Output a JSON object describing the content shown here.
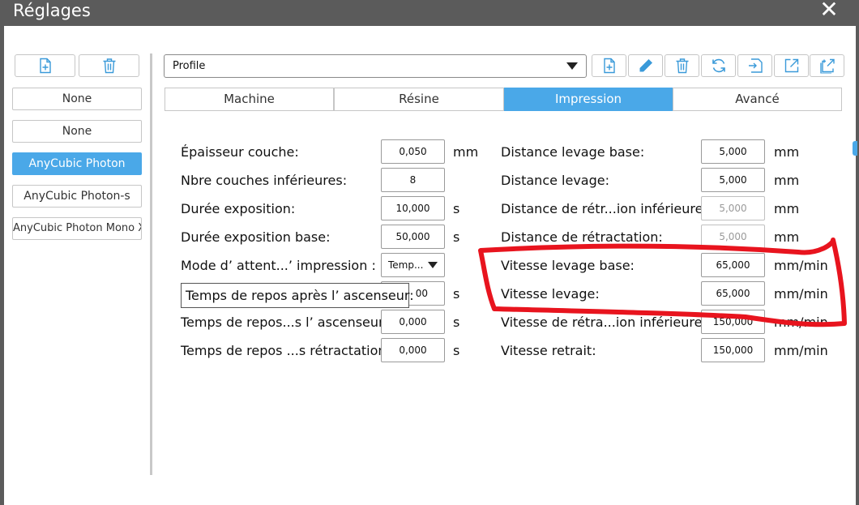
{
  "window": {
    "title": "Réglages",
    "close_glyph": "✕"
  },
  "left_panel": {
    "items": [
      {
        "label": "None"
      },
      {
        "label": "None"
      },
      {
        "label": "AnyCubic Photon"
      },
      {
        "label": "AnyCubic Photon-s"
      },
      {
        "label": "AnyCubic Photon Mono X"
      }
    ],
    "selected_index": 2
  },
  "profile": {
    "value": "Profile"
  },
  "tabs": [
    {
      "label": "Machine"
    },
    {
      "label": "Résine"
    },
    {
      "label": "Impression"
    },
    {
      "label": "Avancé"
    }
  ],
  "active_tab": 2,
  "left_fields": [
    {
      "label": "Épaisseur couche:",
      "value": "0,050",
      "unit": "mm"
    },
    {
      "label": "Nbre couches inférieures:",
      "value": "8",
      "unit": ""
    },
    {
      "label": "Durée exposition:",
      "value": "10,000",
      "unit": "s"
    },
    {
      "label": "Durée exposition base:",
      "value": "50,000",
      "unit": "s"
    },
    {
      "label": "Mode d’ attent...’ impression :",
      "value": "Temp...",
      "unit": ""
    },
    {
      "label": "",
      "value": "00",
      "unit": "s"
    },
    {
      "label": "Temps de repos...s l’ ascenseur:",
      "value": "0,000",
      "unit": "s"
    },
    {
      "label": "Temps de repos ...s rétractation:",
      "value": "0,000",
      "unit": "s"
    }
  ],
  "tooltip": {
    "text": "Temps de repos après l’ ascenseur:"
  },
  "right_fields": [
    {
      "label": "Distance levage base:",
      "value": "5,000",
      "unit": "mm"
    },
    {
      "label": "Distance levage:",
      "value": "5,000",
      "unit": "mm"
    },
    {
      "label": "Distance de rétr...ion inférieure :",
      "value": "5,000",
      "unit": "mm"
    },
    {
      "label": "Distance de rétractation:",
      "value": "5,000",
      "unit": "mm"
    },
    {
      "label": "Vitesse levage base:",
      "value": "65,000",
      "unit": "mm/min"
    },
    {
      "label": "Vitesse levage:",
      "value": "65,000",
      "unit": "mm/min"
    },
    {
      "label": "Vitesse de rétra...ion inférieure :",
      "value": "150,000",
      "unit": "mm/min"
    },
    {
      "label": "Vitesse retrait:",
      "value": "150,000",
      "unit": "mm/min"
    }
  ],
  "colors": {
    "accent": "#4aa8e8",
    "titlebar": "#5b5b5b",
    "annotation": "#e8141e"
  },
  "icons": {
    "left_toolbar": [
      "add-file-icon",
      "trash-icon"
    ],
    "profile_toolbar": [
      "add-file-icon",
      "pencil-icon",
      "trash-icon",
      "refresh-icon",
      "import-icon",
      "export-icon",
      "export-all-icon"
    ]
  }
}
